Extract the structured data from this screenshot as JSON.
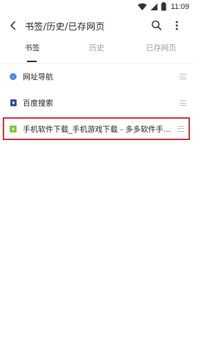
{
  "status_bar": {
    "time": "11:09",
    "icons": [
      "wifi-icon",
      "signal-icon",
      "battery-icon"
    ]
  },
  "header": {
    "title": "书签/历史/已存网页",
    "icons": [
      "back-icon",
      "search-icon",
      "more-vert-icon"
    ]
  },
  "tabs": [
    {
      "label": "书签",
      "active": true
    },
    {
      "label": "历史",
      "active": false
    },
    {
      "label": "已存网页",
      "active": false
    }
  ],
  "bookmarks": [
    {
      "label": "网址导航",
      "icon": "compass-icon",
      "icon_color": "#3d8de0"
    },
    {
      "label": "百度搜索",
      "icon": "baidu-icon",
      "icon_color": "#2a4aa8"
    },
    {
      "label": "手机软件下载_手机游戏下载 - 多多软件手...",
      "icon": "site-icon",
      "icon_color": "#7cc43a",
      "highlighted": true
    }
  ],
  "colors": {
    "highlight_border": "#d9232a",
    "tab_active": "#333333",
    "tab_inactive": "#9a9a9a"
  }
}
